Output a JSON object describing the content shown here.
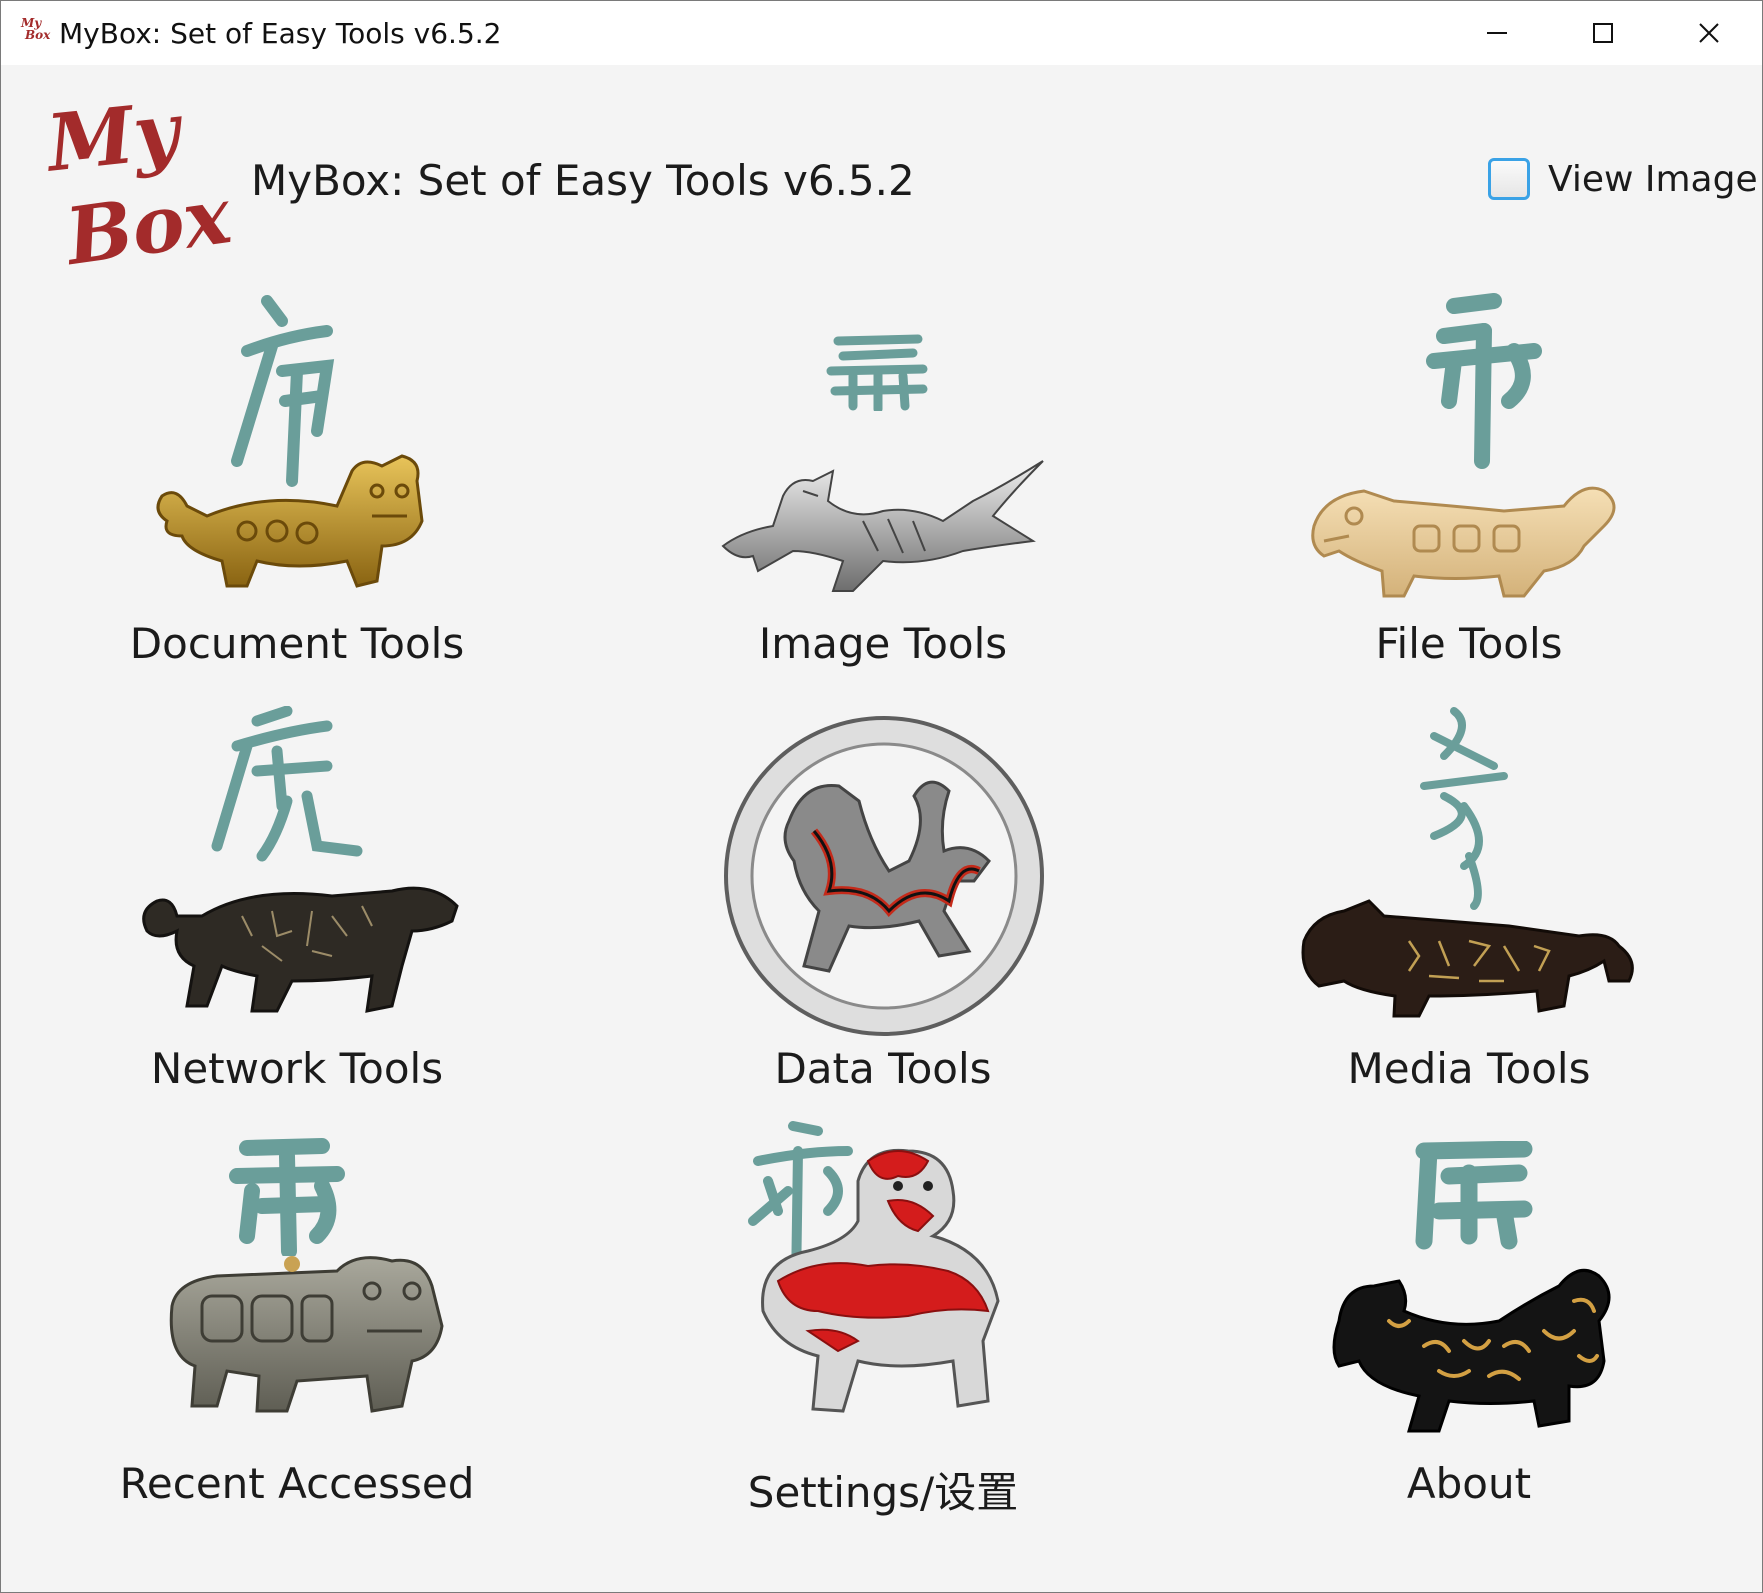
{
  "window": {
    "title": "MyBox: Set of Easy Tools v6.5.2",
    "icon_text_top": "My",
    "icon_text_bottom": "Box",
    "controls": [
      "minimize-icon",
      "maximize-icon",
      "close-icon"
    ]
  },
  "header": {
    "logo_text_top": "My",
    "logo_text_bottom": "Box",
    "title": "MyBox: Set of Easy Tools v6.5.2",
    "view_image_label": "View Image",
    "view_image_checked": false
  },
  "colors": {
    "logo_red": "#a32b2b",
    "glyph_teal": "#6a9e9a",
    "checkbox_border": "#3aa2e6",
    "background": "#f4f4f4"
  },
  "tools": [
    {
      "label": "Document Tools",
      "icon": "gold-tiger-icon"
    },
    {
      "label": "Image Tools",
      "icon": "silver-dragon-icon"
    },
    {
      "label": "File Tools",
      "icon": "jade-tiger-icon"
    },
    {
      "label": "Network Tools",
      "icon": "bronze-tiger-icon"
    },
    {
      "label": "Data Tools",
      "icon": "round-tiger-plaque-icon"
    },
    {
      "label": "Media Tools",
      "icon": "dark-tiger-icon"
    },
    {
      "label": "Recent Accessed",
      "icon": "stone-tiger-icon"
    },
    {
      "label": "Settings/设置",
      "icon": "red-lion-icon"
    },
    {
      "label": "About",
      "icon": "black-gold-tiger-icon"
    }
  ]
}
